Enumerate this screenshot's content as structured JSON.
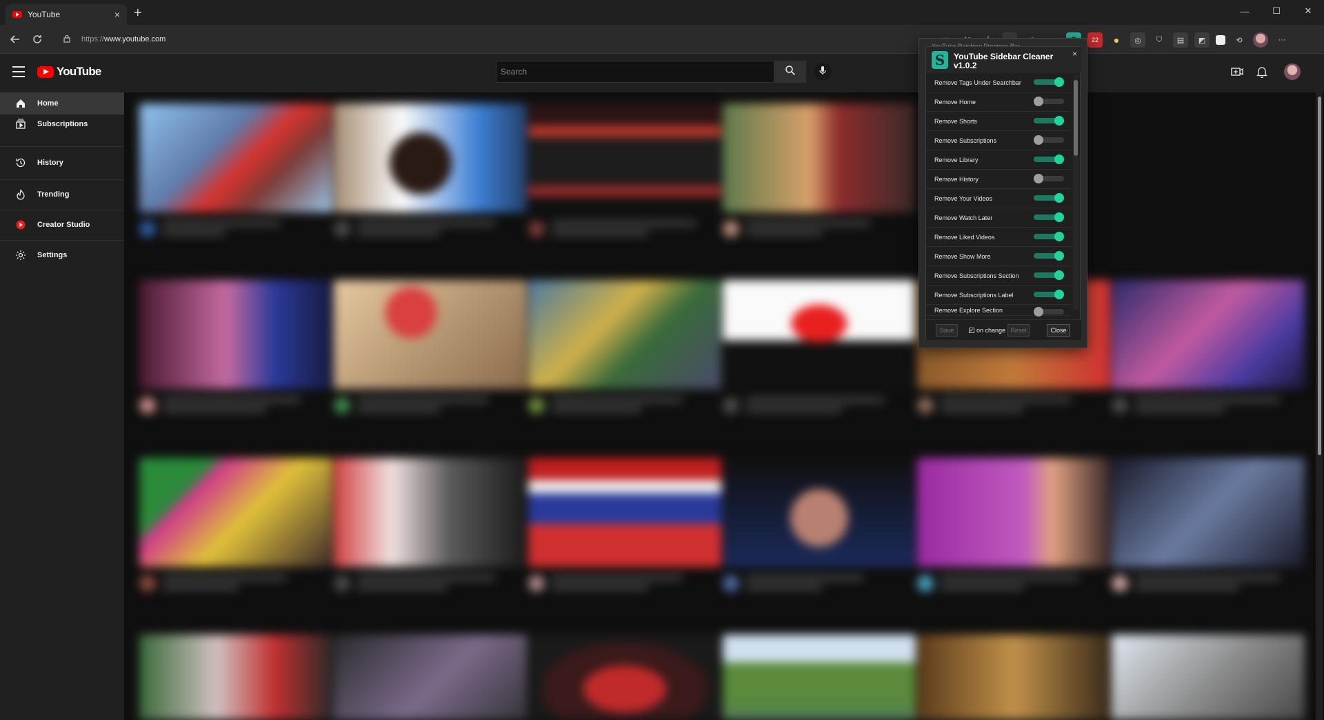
{
  "browser": {
    "tab_title": "YouTube",
    "tab_close": "×",
    "new_tab": "+",
    "url_protocol": "https://",
    "url_host": "www.youtube.com",
    "window_controls": [
      "—",
      "☐",
      "✕"
    ],
    "extension_badge_count": "22"
  },
  "youtube": {
    "logo_text": "YouTube",
    "search_placeholder": "Search",
    "sidebar": {
      "items": [
        {
          "label": "Home",
          "icon": "home-icon",
          "active": true
        },
        {
          "label": "Subscriptions",
          "icon": "subscriptions-icon"
        },
        {
          "label": "History",
          "icon": "history-icon"
        },
        {
          "label": "Trending",
          "icon": "trending-icon"
        },
        {
          "label": "Creator Studio",
          "icon": "creator-studio-icon"
        },
        {
          "label": "Settings",
          "icon": "settings-icon"
        }
      ]
    }
  },
  "extension": {
    "ghost_title": "YouTube Rainbow Progress Bar",
    "logo_letter": "S",
    "title": "YouTube Sidebar Cleaner",
    "version": "v1.0.2",
    "close_x": "×",
    "options": [
      {
        "label": "Remove Tags Under Searchbar",
        "enabled": true
      },
      {
        "label": "Remove Home",
        "enabled": false
      },
      {
        "label": "Remove Shorts",
        "enabled": true
      },
      {
        "label": "Remove Subscriptions",
        "enabled": false
      },
      {
        "label": "Remove Library",
        "enabled": true
      },
      {
        "label": "Remove History",
        "enabled": false
      },
      {
        "label": "Remove Your Videos",
        "enabled": true
      },
      {
        "label": "Remove Watch Later",
        "enabled": true
      },
      {
        "label": "Remove Liked Videos",
        "enabled": true
      },
      {
        "label": "Remove Show More",
        "enabled": true
      },
      {
        "label": "Remove Subscriptions Section",
        "enabled": true
      },
      {
        "label": "Remove Subscriptions Label",
        "enabled": true
      },
      {
        "label": "Remove Explore Section",
        "enabled": false
      }
    ],
    "footer": {
      "save": "Save",
      "on_change": "on change",
      "on_change_checked": true,
      "reset": "Reset",
      "close": "Close"
    }
  }
}
